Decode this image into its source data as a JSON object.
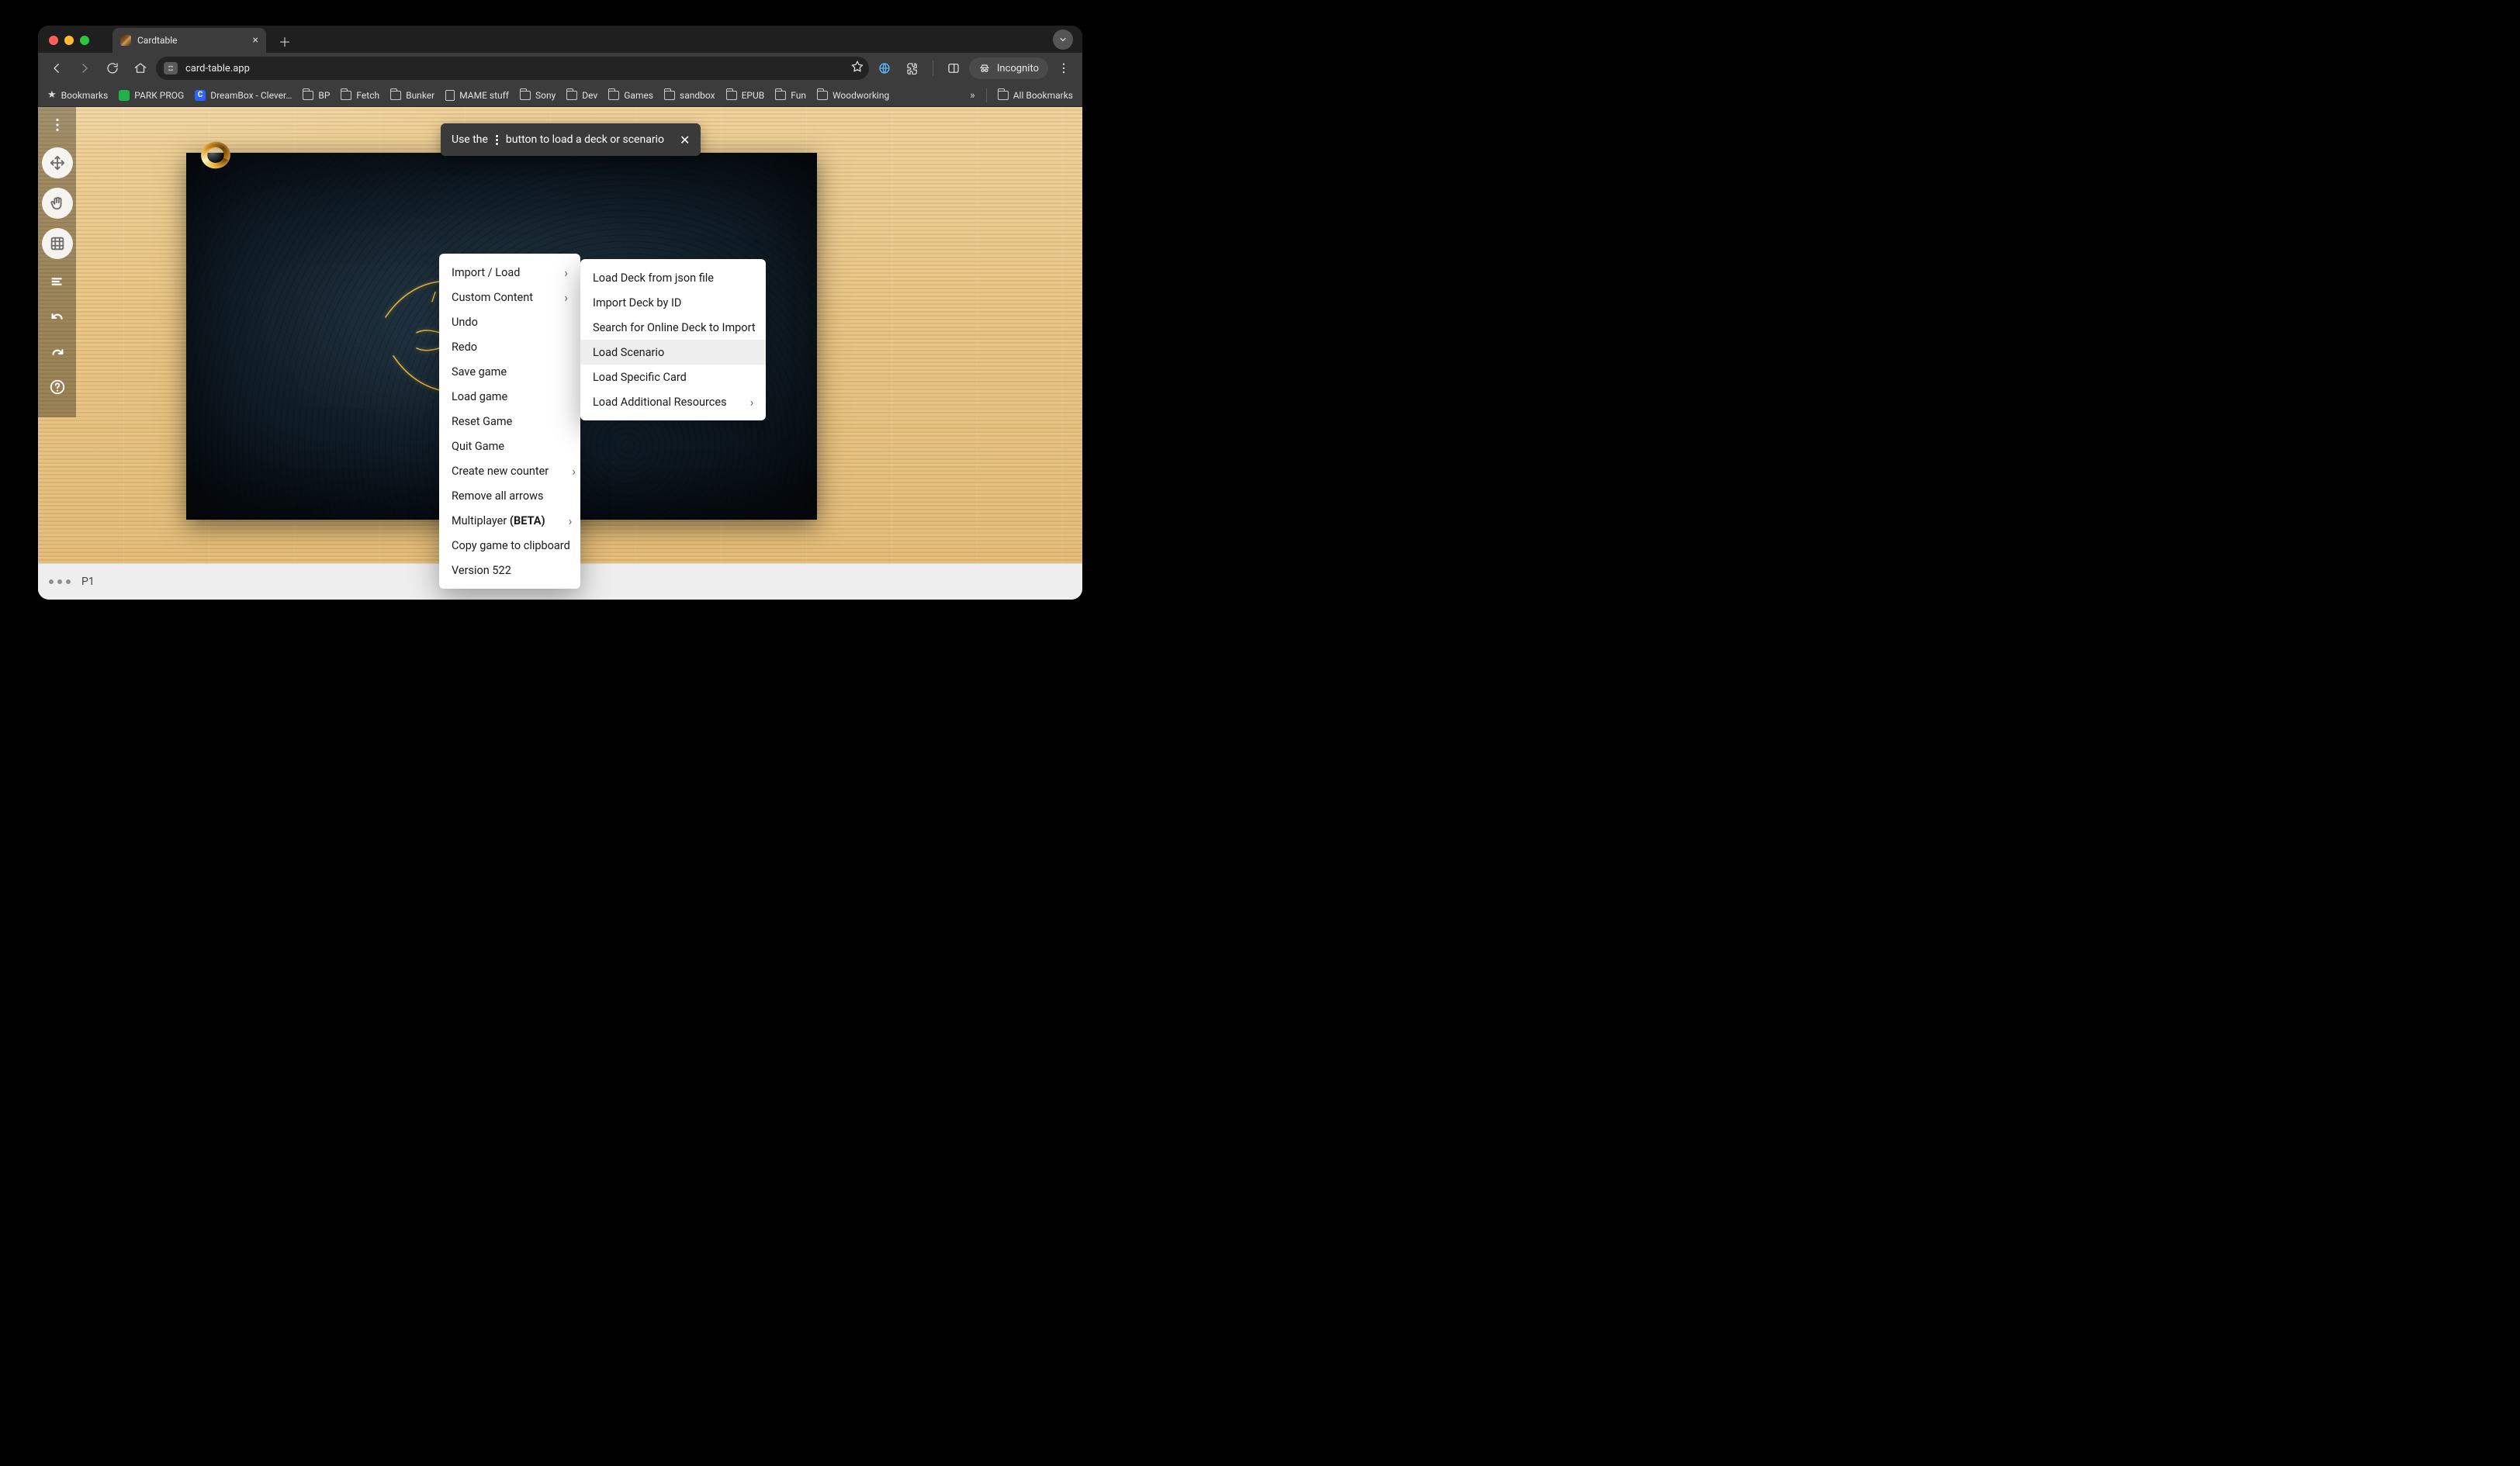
{
  "browser": {
    "tab": {
      "title": "Cardtable"
    },
    "url": "card-table.app",
    "incognito_label": "Incognito",
    "bookmarks": [
      {
        "kind": "star",
        "label": "Bookmarks"
      },
      {
        "kind": "green",
        "label": "PARK PROG"
      },
      {
        "kind": "blue-c",
        "label": "DreamBox - Clever…"
      },
      {
        "kind": "folder",
        "label": "BP"
      },
      {
        "kind": "folder",
        "label": "Fetch"
      },
      {
        "kind": "folder",
        "label": "Bunker"
      },
      {
        "kind": "doc",
        "label": "MAME stuff"
      },
      {
        "kind": "folder",
        "label": "Sony"
      },
      {
        "kind": "folder",
        "label": "Dev"
      },
      {
        "kind": "folder",
        "label": "Games"
      },
      {
        "kind": "folder",
        "label": "sandbox"
      },
      {
        "kind": "folder",
        "label": "EPUB"
      },
      {
        "kind": "folder",
        "label": "Fun"
      },
      {
        "kind": "folder",
        "label": "Woodworking"
      }
    ],
    "all_bookmarks_label": "All Bookmarks"
  },
  "hint": {
    "pre": "Use the",
    "post": "button to load a deck or scenario"
  },
  "menu_main": {
    "items": [
      {
        "label": "Import / Load",
        "submenu": true
      },
      {
        "label": "Custom Content",
        "submenu": true
      },
      {
        "label": "Undo",
        "submenu": false
      },
      {
        "label": "Redo",
        "submenu": false
      },
      {
        "label": "Save game",
        "submenu": false
      },
      {
        "label": "Load game",
        "submenu": false
      },
      {
        "label": "Reset Game",
        "submenu": false
      },
      {
        "label": "Quit Game",
        "submenu": false
      },
      {
        "label": "Create new counter",
        "submenu": true
      },
      {
        "label": "Remove all arrows",
        "submenu": false
      },
      {
        "label_prefix": "Multiplayer ",
        "label_bold": "(BETA)",
        "submenu": true
      },
      {
        "label": "Copy game to clipboard",
        "submenu": false
      },
      {
        "label": "Version 522",
        "submenu": false
      }
    ]
  },
  "menu_sub": {
    "items": [
      {
        "label": "Load Deck from json file",
        "submenu": false
      },
      {
        "label": "Import Deck by ID",
        "submenu": false
      },
      {
        "label": "Search for Online Deck to Import",
        "submenu": false
      },
      {
        "label": "Load Scenario",
        "submenu": false,
        "highlight": true
      },
      {
        "label": "Load Specific Card",
        "submenu": false
      },
      {
        "label": "Load Additional Resources",
        "submenu": true
      }
    ]
  },
  "status": {
    "player": "P1"
  }
}
